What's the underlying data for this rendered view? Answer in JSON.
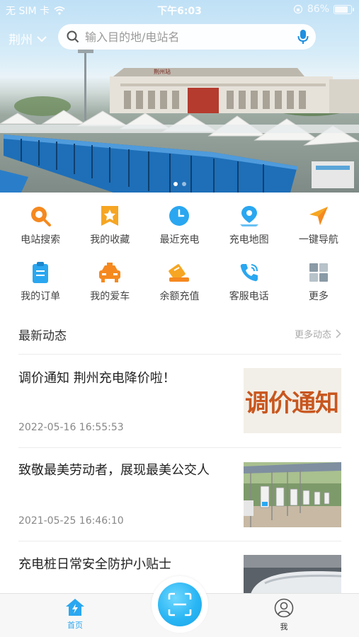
{
  "status_bar": {
    "carrier": "无 SIM 卡",
    "time": "下午6:03",
    "battery": "86%",
    "battery_level": 0.86
  },
  "header": {
    "city": "荆州",
    "search_placeholder": "输入目的地/电站名"
  },
  "banner": {
    "station_sign": "荆州站",
    "page_count": 2,
    "active_page": 1
  },
  "quick_actions": [
    {
      "label": "电站搜索",
      "icon": "station-search-icon"
    },
    {
      "label": "我的收藏",
      "icon": "favorite-icon"
    },
    {
      "label": "最近充电",
      "icon": "clock-icon"
    },
    {
      "label": "充电地图",
      "icon": "map-pin-icon"
    },
    {
      "label": "一键导航",
      "icon": "navigate-icon"
    },
    {
      "label": "我的订单",
      "icon": "order-icon"
    },
    {
      "label": "我的爱车",
      "icon": "car-icon"
    },
    {
      "label": "余额充值",
      "icon": "recharge-icon"
    },
    {
      "label": "客服电话",
      "icon": "phone-icon"
    },
    {
      "label": "更多",
      "icon": "more-grid-icon"
    }
  ],
  "news": {
    "title": "最新动态",
    "more": "更多动态",
    "items": [
      {
        "title": "调价通知 荆州充电降价啦！",
        "date": "2022-05-16 16:55:53",
        "thumb_text": "调价通知"
      },
      {
        "title": "致敬最美劳动者，展现最美公交人",
        "date": "2021-05-25 16:46:10"
      },
      {
        "title": "充电桩日常安全防护小贴士"
      }
    ]
  },
  "tabbar": {
    "home": "首页",
    "me": "我"
  },
  "colors": {
    "accent": "#2aa7f0",
    "orange": "#f5891f"
  }
}
